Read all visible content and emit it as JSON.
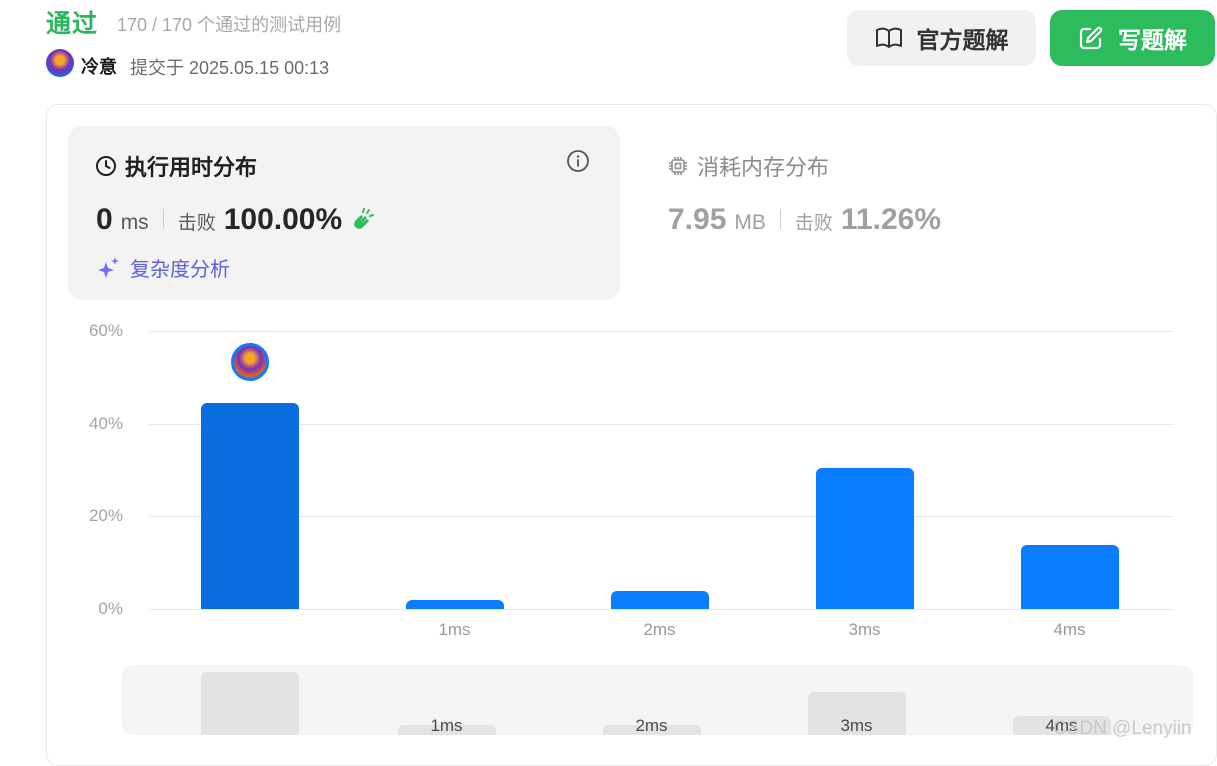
{
  "header": {
    "status": "通过",
    "cases": "170 / 170 个通过的测试用例",
    "username": "冷意",
    "submitted": "提交于 2025.05.15 00:13",
    "official_solution": "官方题解",
    "write_solution": "写题解"
  },
  "runtime": {
    "title": "执行用时分布",
    "value": "0",
    "unit": "ms",
    "beat_label": "击败",
    "beat_pct": "100.00%",
    "complexity": "复杂度分析"
  },
  "memory": {
    "title": "消耗内存分布",
    "value": "7.95",
    "unit": "MB",
    "beat_label": "击败",
    "beat_pct": "11.26%"
  },
  "colors": {
    "accept_green": "#2db55d",
    "bar_blue": "#0a7cff",
    "bar_selected": "#0b6ee0",
    "btn_green": "#2cbb5d"
  },
  "chart_data": {
    "type": "bar",
    "categories": [
      "",
      "1ms",
      "2ms",
      "3ms",
      "4ms"
    ],
    "values": [
      44.5,
      2,
      3.8,
      30.4,
      13.8
    ],
    "selected_index": 0,
    "yticks": [
      "60%",
      "40%",
      "20%",
      "0%"
    ],
    "ylim": [
      0,
      60
    ],
    "xlabel": "",
    "ylabel": "",
    "grid": true
  },
  "overview": {
    "labels": [
      "",
      "1ms",
      "2ms",
      "3ms",
      "4ms"
    ]
  },
  "watermark": "CSDN @Lenyiin"
}
